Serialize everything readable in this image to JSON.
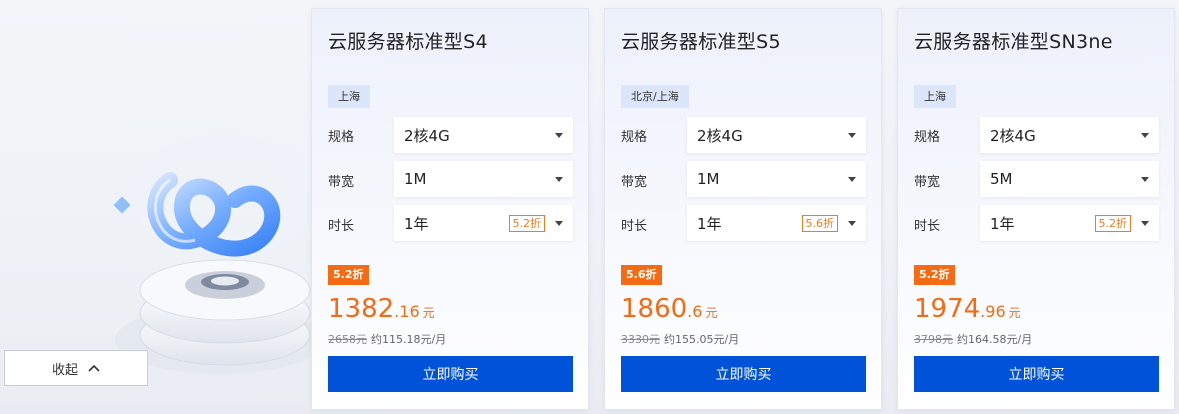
{
  "collapse": {
    "label": "收起"
  },
  "labels": {
    "spec": "规格",
    "bandwidth": "带宽",
    "duration": "时长"
  },
  "cards": [
    {
      "title": "云服务器标准型S4",
      "region": "上海",
      "spec": "2核4G",
      "bandwidth": "1M",
      "duration": "1年",
      "duration_discount": "5.2折",
      "badge": "5.2折",
      "price_int": "1382",
      "price_dec": ".16",
      "price_unit": "元",
      "orig_price": "2658元",
      "monthly": "约115.18元/月",
      "buy": "立即购买"
    },
    {
      "title": "云服务器标准型S5",
      "region": "北京/上海",
      "spec": "2核4G",
      "bandwidth": "1M",
      "duration": "1年",
      "duration_discount": "5.6折",
      "badge": "5.6折",
      "price_int": "1860",
      "price_dec": ".6",
      "price_unit": "元",
      "orig_price": "3330元",
      "monthly": "约155.05元/月",
      "buy": "立即购买"
    },
    {
      "title": "云服务器标准型SN3ne",
      "region": "上海",
      "spec": "2核4G",
      "bandwidth": "5M",
      "duration": "1年",
      "duration_discount": "5.2折",
      "badge": "5.2折",
      "price_int": "1974",
      "price_dec": ".96",
      "price_unit": "元",
      "orig_price": "3798元",
      "monthly": "约164.58元/月",
      "buy": "立即购买"
    }
  ],
  "colors": {
    "accent": "#0052d9",
    "discount": "#f56a12",
    "tag_bg": "#dbe6fb"
  }
}
